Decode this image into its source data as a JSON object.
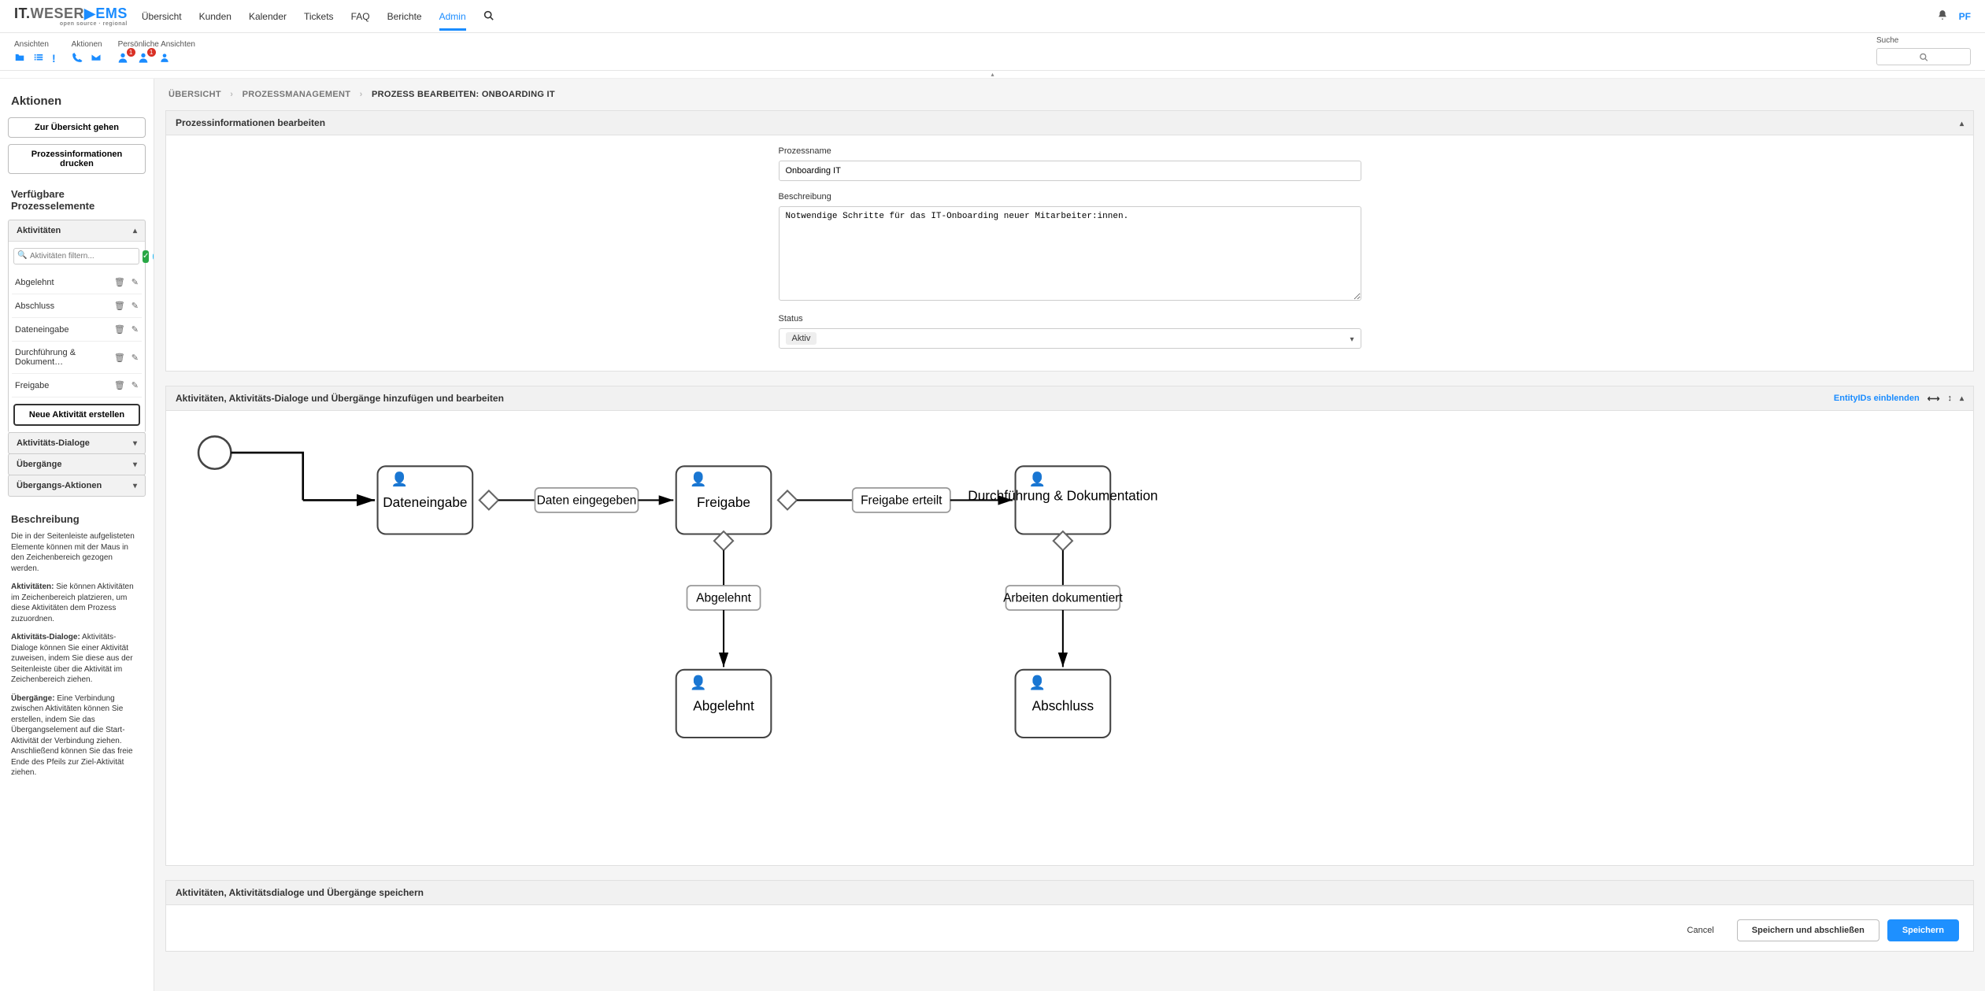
{
  "brand": {
    "it": "IT.",
    "weser": "WESER",
    "ems": "EMS",
    "tag": "open source · regional"
  },
  "nav": {
    "items": [
      "Übersicht",
      "Kunden",
      "Kalender",
      "Tickets",
      "FAQ",
      "Berichte",
      "Admin"
    ],
    "activeIndex": 6
  },
  "avatar": "PF",
  "subnav": {
    "groups": [
      {
        "label": "Ansichten"
      },
      {
        "label": "Aktionen"
      },
      {
        "label": "Persönliche Ansichten",
        "badge1": "1",
        "badge2": "1"
      }
    ],
    "searchLabel": "Suche"
  },
  "sidebar": {
    "actionsTitle": "Aktionen",
    "btnOverview": "Zur Übersicht gehen",
    "btnPrint": "Prozessinformationen drucken",
    "elementsTitle": "Verfügbare Prozesselemente",
    "accActivities": "Aktivitäten",
    "filterPlaceholder": "Aktivitäten filtern...",
    "activities": [
      "Abgelehnt",
      "Abschluss",
      "Dateneingabe",
      "Durchführung & Dokument…",
      "Freigabe"
    ],
    "newActivityBtn": "Neue Aktivität erstellen",
    "accDialogs": "Aktivitäts-Dialoge",
    "accTransitions": "Übergänge",
    "accTransActions": "Übergangs-Aktionen",
    "descTitle": "Beschreibung",
    "desc1": "Die in der Seitenleiste aufgelisteten Elemente können mit der Maus in den Zeichenbereich gezogen werden.",
    "desc2b": "Aktivitäten:",
    "desc2": " Sie können Aktivitäten im Zeichenbereich platzieren, um diese Aktivitäten dem Prozess zuzuordnen.",
    "desc3b": "Aktivitäts-Dialoge:",
    "desc3": " Aktivitäts-Dialoge können Sie einer Aktivität zuweisen, indem Sie diese aus der Seitenleiste über die Aktivität im Zeichenbereich ziehen.",
    "desc4b": "Übergänge:",
    "desc4": " Eine Verbindung zwischen Aktivitäten können Sie erstellen, indem Sie das Übergangselement auf die Start-Aktivität der Verbindung ziehen. Anschließend können Sie das freie Ende des Pfeils zur Ziel-Aktivität ziehen."
  },
  "crumbs": {
    "a": "ÜBERSICHT",
    "b": "PROZESSMANAGEMENT",
    "c": "PROZESS BEARBEITEN: ONBOARDING IT"
  },
  "panel1": {
    "title": "Prozessinformationen bearbeiten",
    "nameLabel": "Prozessname",
    "nameValue": "Onboarding IT",
    "descLabel": "Beschreibung",
    "descValue": "Notwendige Schritte für das IT-Onboarding neuer Mitarbeiter:innen.",
    "statusLabel": "Status",
    "statusValue": "Aktiv"
  },
  "panel2": {
    "title": "Aktivitäten, Aktivitäts-Dialoge und Übergänge hinzufügen und bearbeiten",
    "entityLink": "EntityIDs einblenden",
    "nodes": {
      "n1": "Dateneingabe",
      "n2": "Freigabe",
      "n3": "Durchführung & Dokumentation",
      "n4": "Abgelehnt",
      "n5": "Abschluss"
    },
    "trans": {
      "t1": "Daten eingegeben",
      "t2": "Freigabe erteilt",
      "t3": "Abgelehnt",
      "t4": "Arbeiten dokumentiert"
    }
  },
  "panel3": {
    "title": "Aktivitäten, Aktivitätsdialoge und Übergänge speichern",
    "cancel": "Cancel",
    "saveClose": "Speichern und abschließen",
    "save": "Speichern"
  }
}
